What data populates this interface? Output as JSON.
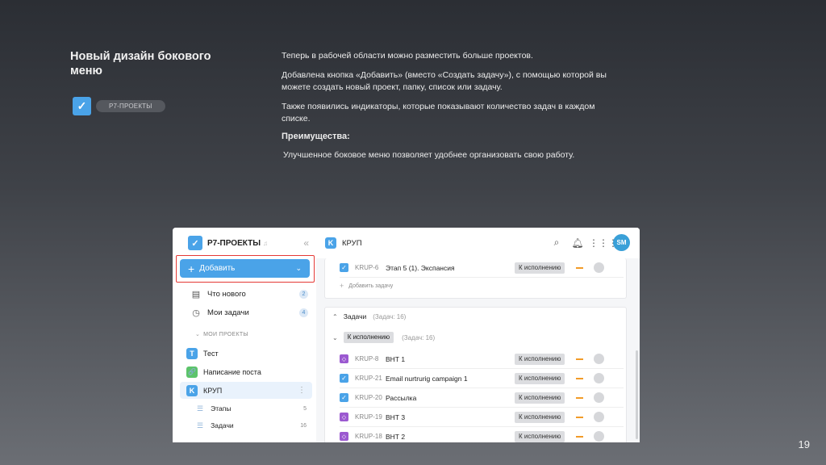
{
  "slide": {
    "title": "Новый дизайн бокового меню",
    "brand_chip": "Р7-ПРОЕКТЫ",
    "paragraphs": [
      "Теперь в рабочей области можно разместить больше проектов.",
      "Добавлена кнопка «Добавить» (вместо «Создать задачу»), с помощью которой вы можете создать новый проект, папку, список или задачу.",
      "Также появились индикаторы, которые показывают количество задач в каждом списке."
    ],
    "advantages_title": "Преимущества:",
    "advantages_text": "Улучшенное боковое меню позволяет удобнее организовать свою работу.",
    "page_number": "19"
  },
  "app": {
    "name": "Р7-ПРОЕКТЫ",
    "add_label": "Добавить",
    "nav": [
      {
        "label": "Что нового",
        "count": "2"
      },
      {
        "label": "Мои задачи",
        "count": "4"
      }
    ],
    "section_label": "МОИ ПРОЕКТЫ",
    "projects": [
      {
        "letter": "T",
        "label": "Тест",
        "color": "#4aa3e8"
      },
      {
        "letter": "🔗",
        "label": "Написание поста",
        "color": "#5cc46a"
      },
      {
        "letter": "K",
        "label": "КРУП",
        "color": "#4aa3e8"
      }
    ],
    "sublists": [
      {
        "label": "Этапы",
        "count": "5"
      },
      {
        "label": "Задачи",
        "count": "16"
      }
    ],
    "breadcrumb": {
      "letter": "K",
      "label": "КРУП"
    },
    "avatar": "SM",
    "top_row": {
      "key": "KRUP-6",
      "title": "Этап 5 (1). Экспансия",
      "status": "К исполнению"
    },
    "add_task": "Добавить задачу",
    "group": {
      "title": "Задачи",
      "meta": "(Задач: 16)"
    },
    "status_group": {
      "label": "К исполнению",
      "meta": "(Задач: 16)"
    },
    "tasks": [
      {
        "key": "KRUP-8",
        "title": "ВНТ 1",
        "status": "К исполнению",
        "type": "diamond"
      },
      {
        "key": "KRUP-21",
        "title": "Email nurtrurig campaign 1",
        "status": "К исполнению",
        "type": "check"
      },
      {
        "key": "KRUP-20",
        "title": "Рассылка",
        "status": "К исполнению",
        "type": "check"
      },
      {
        "key": "KRUP-19",
        "title": "ВНТ 3",
        "status": "К исполнению",
        "type": "diamond"
      },
      {
        "key": "KRUP-18",
        "title": "ВНТ 2",
        "status": "К исполнению",
        "type": "diamond"
      }
    ]
  }
}
